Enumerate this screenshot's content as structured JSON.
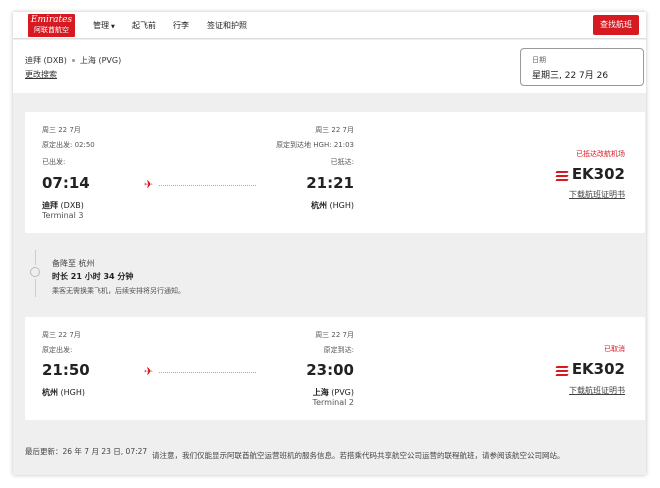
{
  "header": {
    "logo_en": "Emirates",
    "logo_cn": "阿联酋航空",
    "nav": [
      "管理",
      "起飞前",
      "行李",
      "签证和护照"
    ],
    "search_button": "查找航班"
  },
  "route": {
    "origin": "迪拜 (DXB)",
    "destination": "上海 (PVG)",
    "change_search": "更改搜索",
    "date_label": "日期",
    "date_value": "星期三, 22 7月 26"
  },
  "flight1": {
    "dep_date": "周三 22 7月",
    "dep_scheduled": "原定出发: 02:50",
    "dep_status_label": "已出发:",
    "dep_time": "07:14",
    "dep_city": "迪拜",
    "dep_code": "(DXB)",
    "dep_terminal": "Terminal 3",
    "arr_date": "周三 22 7月",
    "arr_scheduled": "原定到达地 HGH: 21:03",
    "arr_status_label": "已抵达:",
    "arr_time": "21:21",
    "arr_city": "杭州",
    "arr_code": "(HGH)",
    "status": "已抵达改航机场",
    "flight_number": "EK302",
    "certificate_link": "下载航班证明书"
  },
  "divert": {
    "line1": "备降至 杭州",
    "line2": "时长 21 小时 34 分钟",
    "line3": "乘客无需换乘飞机，后续安排将另行通知。"
  },
  "flight2": {
    "dep_date": "周三 22 7月",
    "dep_scheduled": "原定出发:",
    "dep_time": "21:50",
    "dep_city": "杭州",
    "dep_code": "(HGH)",
    "arr_date": "周三 22 7月",
    "arr_scheduled": "原定到达:",
    "arr_time": "23:00",
    "arr_city": "上海",
    "arr_code": "(PVG)",
    "arr_terminal": "Terminal 2",
    "status": "已取消",
    "flight_number": "EK302",
    "certificate_link": "下载航班证明书"
  },
  "footer": {
    "last_updated": "最后更新：26 年 7 月 23 日, 07:27",
    "notice": "请注意，我们仅能显示阿联酋航空运营班机的服务信息。若搭乘代码共享航空公司运营的联程航班，请参阅该航空公司网站。"
  },
  "colors": {
    "brand_red": "#d71921",
    "page_bg": "#efefef",
    "card_bg": "#ffffff"
  }
}
